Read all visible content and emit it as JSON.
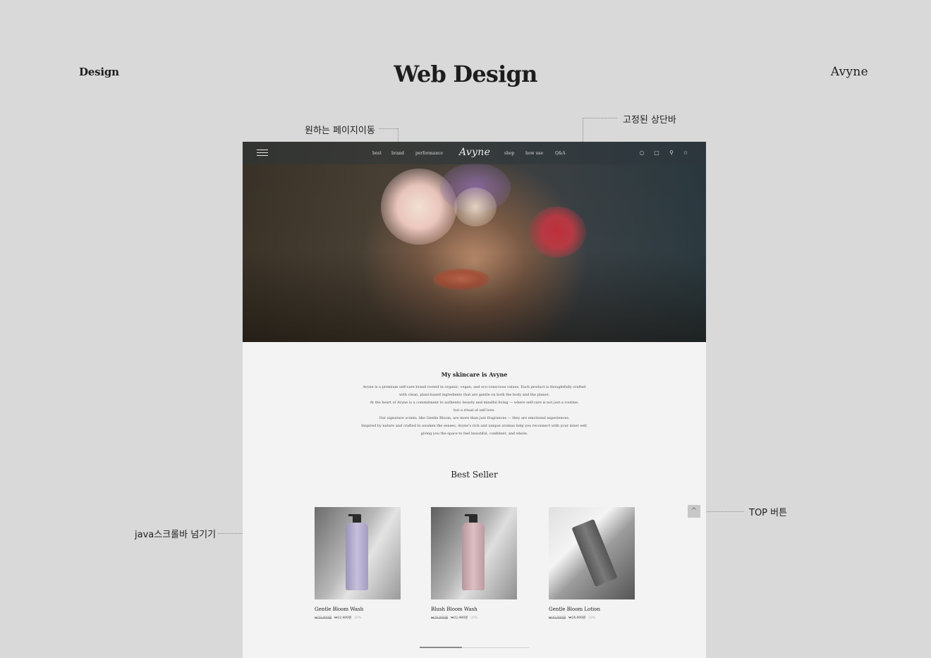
{
  "header": {
    "left_label": "Design",
    "title": "Web Design",
    "right_label": "Avyne"
  },
  "annotations": {
    "page_move": "원하는 페이지이동",
    "fixed_bar": "고정된 상단바",
    "top_button": "TOP 버튼",
    "scroll_slider": "java스크롤바 넘기기"
  },
  "mockup": {
    "nav": {
      "logo": "Avyne",
      "left_items": [
        "best",
        "brand",
        "performance"
      ],
      "right_items": [
        "shop",
        "how use",
        "Q&A"
      ],
      "icons": [
        "user-icon",
        "cart-icon",
        "search-icon",
        "star-icon"
      ]
    },
    "intro": {
      "title": "My skincare is Avyne",
      "lines": [
        "Avyne is a premium self-care brand rooted in organic, vegan, and eco-conscious values. Each product is thoughtfully crafted",
        "with clean, plant-based ingredients that are gentle on both the body and the planet.",
        "At the heart of Avyne is a commitment to authentic beauty and mindful living — where self-care is not just a routine,",
        "but a ritual of self love.",
        "Our signature scents, like Gentle Bloom, are more than just fragrances — they are emotional experiences.",
        "Inspired by nature and crafted to awaken the senses, Avyne's rich and unique aromas help you reconnect with your inner self,",
        "giving you the space to feel beautiful, confident, and whole."
      ]
    },
    "best_seller": {
      "title": "Best Seller",
      "products": [
        {
          "name": "Gentle Bloom Wash",
          "old_price": "₩28,000원",
          "price": "₩22,400원",
          "rate": "20%"
        },
        {
          "name": "Blush Bloom Wash",
          "old_price": "₩28,000원",
          "price": "₩22,400원",
          "rate": "20%"
        },
        {
          "name": "Gentle Bloom Lotion",
          "old_price": "₩30,000원",
          "price": "₩24,000원",
          "rate": "20%"
        }
      ]
    },
    "top_button_glyph": "^"
  }
}
